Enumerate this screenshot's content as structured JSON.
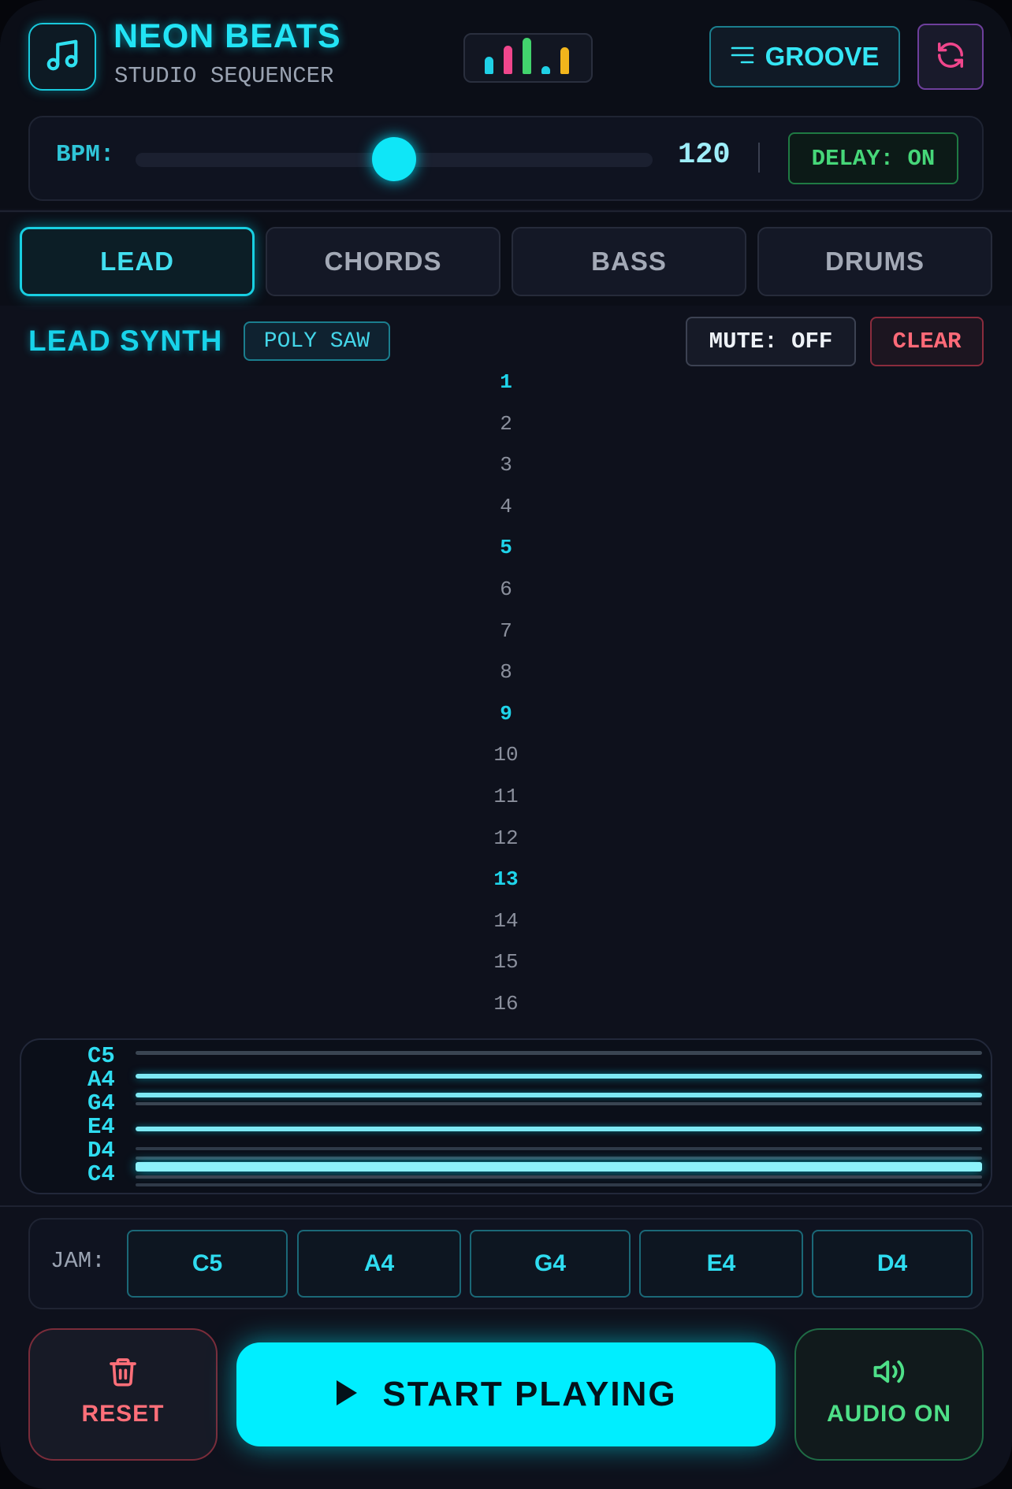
{
  "header": {
    "title": "NEON BEATS",
    "subtitle": "STUDIO SEQUENCER",
    "logo_icon": "music-note-icon",
    "equalizer_colors": [
      "#1fd0e6",
      "#f0468c",
      "#42d36d",
      "#1fd0e6",
      "#f2b51c"
    ],
    "groove_label": "GROOVE",
    "refresh_icon": "refresh-icon"
  },
  "bpm": {
    "label": "BPM:",
    "value": "120",
    "slider_fraction": 0.5,
    "delay_label": "DELAY: ON"
  },
  "tabs": [
    {
      "label": "LEAD",
      "active": true
    },
    {
      "label": "CHORDS",
      "active": false
    },
    {
      "label": "BASS",
      "active": false
    },
    {
      "label": "DRUMS",
      "active": false
    }
  ],
  "track": {
    "title": "LEAD SYNTH",
    "preset": "POLY SAW",
    "mute_label": "MUTE: OFF",
    "clear_label": "CLEAR",
    "steps": [
      "1",
      "2",
      "3",
      "4",
      "5",
      "6",
      "7",
      "8",
      "9",
      "10",
      "11",
      "12",
      "13",
      "14",
      "15",
      "16"
    ],
    "beat_steps": [
      "1",
      "5",
      "9",
      "13"
    ]
  },
  "piano_roll": {
    "notes": [
      "C5",
      "A4",
      "G4",
      "E4",
      "D4",
      "C4"
    ]
  },
  "jam": {
    "label": "JAM:",
    "keys": [
      "C5",
      "A4",
      "G4",
      "E4",
      "D4"
    ]
  },
  "controls": {
    "reset_label": "RESET",
    "play_label": "START PLAYING",
    "audio_label": "AUDIO ON"
  },
  "colors": {
    "accent": "#00eeff",
    "danger": "#ff6a78",
    "success": "#46d779",
    "background": "#0e111c"
  }
}
